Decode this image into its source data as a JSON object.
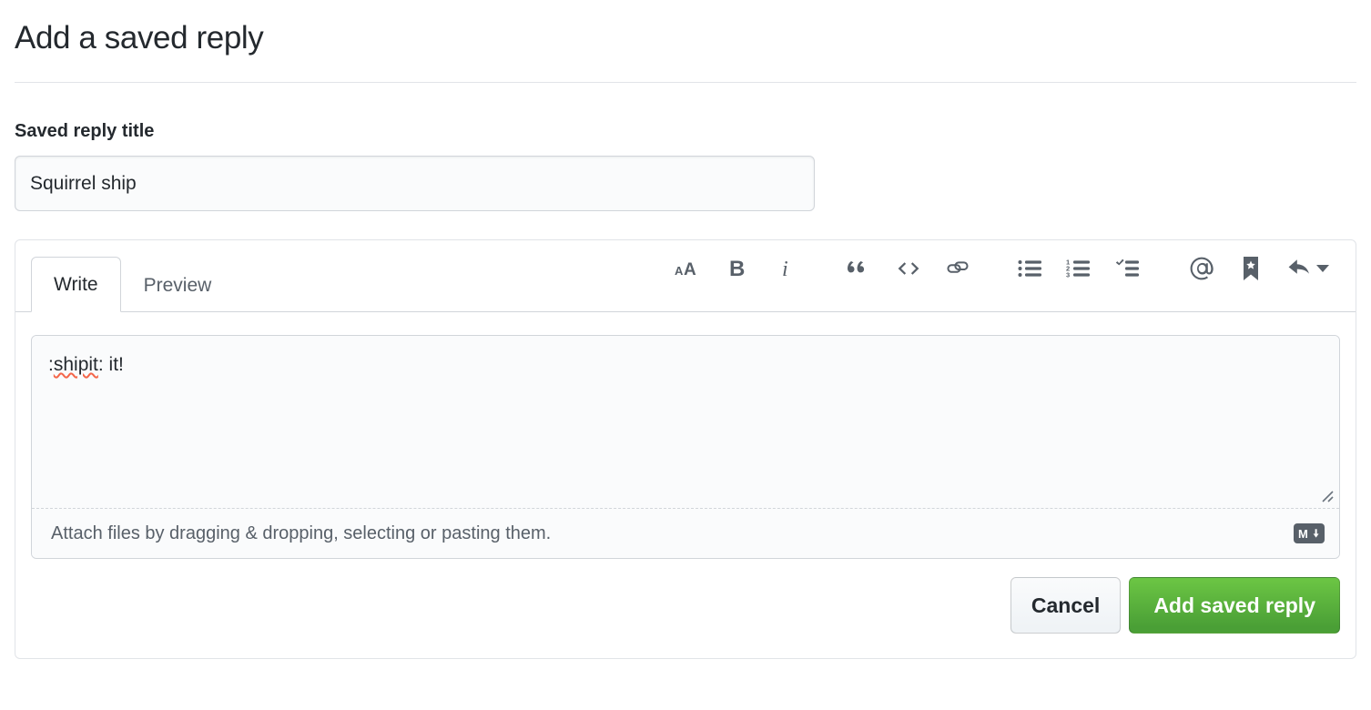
{
  "header": {
    "title": "Add a saved reply"
  },
  "title_field": {
    "label": "Saved reply title",
    "value": "Squirrel ship",
    "placeholder": "Saved reply title"
  },
  "composer": {
    "tabs": [
      {
        "label": "Write",
        "active": true
      },
      {
        "label": "Preview",
        "active": false
      }
    ],
    "toolbar": {
      "groups": [
        {
          "buttons": [
            {
              "name": "heading-icon",
              "label": "Add heading text"
            },
            {
              "name": "bold-icon",
              "label": "Add bold text"
            },
            {
              "name": "italic-icon",
              "label": "Add italic text"
            }
          ]
        },
        {
          "buttons": [
            {
              "name": "quote-icon",
              "label": "Insert a quote"
            },
            {
              "name": "code-icon",
              "label": "Insert code"
            },
            {
              "name": "link-icon",
              "label": "Add a link"
            }
          ]
        },
        {
          "buttons": [
            {
              "name": "unordered-list-icon",
              "label": "Add a bulleted list"
            },
            {
              "name": "ordered-list-icon",
              "label": "Add a numbered list"
            },
            {
              "name": "task-list-icon",
              "label": "Add a task list"
            }
          ]
        },
        {
          "buttons": [
            {
              "name": "mention-icon",
              "label": "Directly mention a user or team"
            },
            {
              "name": "saved-reply-icon",
              "label": "Reference an issue, pull request, or discussion"
            },
            {
              "name": "reply-icon",
              "label": "Add saved reply"
            }
          ]
        }
      ]
    },
    "editor": {
      "value": ":shipit: it!",
      "misspelled_word": "shipit",
      "text_before_misspell": ":",
      "text_after_misspell": ": it!",
      "placeholder": "",
      "resize_handle": "resize-grip"
    },
    "attach": {
      "text": "Attach files by dragging & dropping, selecting or pasting them.",
      "markdown_badge": "markdown-icon"
    },
    "actions": {
      "cancel_label": "Cancel",
      "submit_label": "Add saved reply"
    }
  },
  "colors": {
    "accent_green_top": "#6cc644",
    "accent_green_bottom": "#4a9f36",
    "text_primary": "#24292e",
    "text_muted": "#586069",
    "border": "#d1d5da",
    "border_light": "#e1e4e8",
    "field_bg": "#fafbfc",
    "spellcheck_red": "#f4664a"
  }
}
